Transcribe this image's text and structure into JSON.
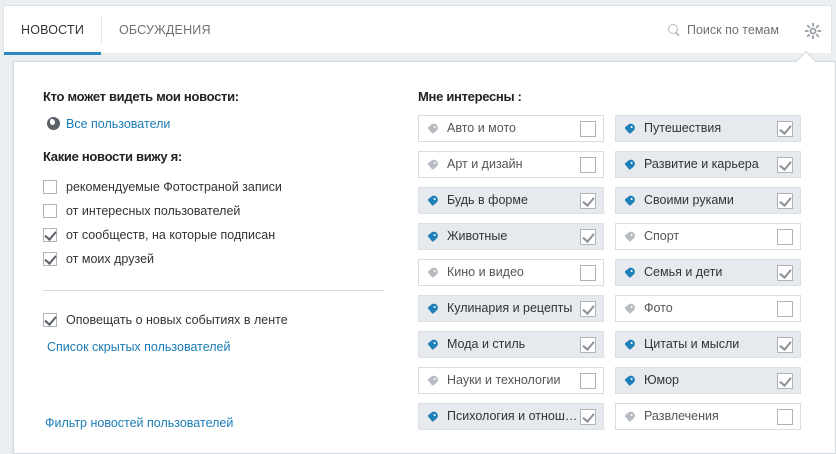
{
  "tabs": {
    "news": "НОВОСТИ",
    "discussions": "ОБСУЖДЕНИЯ"
  },
  "search": {
    "placeholder": "Поиск по темам",
    "icon": "search-icon"
  },
  "settings_icon": "gear-icon",
  "colors": {
    "accent": "#2a8cbe",
    "link": "#1a7bb6",
    "selected_bg": "#e6eaee",
    "tag_selected": "#1f7fb8"
  },
  "visibility": {
    "heading": "Кто может видеть мои новости:",
    "value": "Все пользователи",
    "icon": "globe-icon"
  },
  "feed": {
    "heading": "Какие новости вижу я:",
    "options": [
      {
        "label": "рекомендуемые Фотостраной записи",
        "checked": false
      },
      {
        "label": "от интересных пользователей",
        "checked": false
      },
      {
        "label": "от сообществ, на которые подписан",
        "checked": true
      },
      {
        "label": "от моих друзей",
        "checked": true
      }
    ]
  },
  "notify": {
    "label": "Оповещать о новых событиях в ленте",
    "checked": true
  },
  "hidden_users_link": "Список скрытых пользователей",
  "filter_link": "Фильтр новостей пользователей",
  "interests": {
    "heading": "Мне интересны :",
    "left": [
      {
        "label": "Авто и мото",
        "selected": false
      },
      {
        "label": "Арт и дизайн",
        "selected": false
      },
      {
        "label": "Будь в форме",
        "selected": true
      },
      {
        "label": "Животные",
        "selected": true
      },
      {
        "label": "Кино и видео",
        "selected": false
      },
      {
        "label": "Кулинария и рецепты",
        "selected": true
      },
      {
        "label": "Мода и стиль",
        "selected": true
      },
      {
        "label": "Науки и технологии",
        "selected": false
      },
      {
        "label": "Психология и отнош…",
        "selected": true
      }
    ],
    "right": [
      {
        "label": "Путешествия",
        "selected": true
      },
      {
        "label": "Развитие и карьера",
        "selected": true
      },
      {
        "label": "Своими руками",
        "selected": true
      },
      {
        "label": "Спорт",
        "selected": false
      },
      {
        "label": "Семья и дети",
        "selected": true
      },
      {
        "label": "Фото",
        "selected": false
      },
      {
        "label": "Цитаты и мысли",
        "selected": true
      },
      {
        "label": "Юмор",
        "selected": true
      },
      {
        "label": "Развлечения",
        "selected": false
      }
    ]
  }
}
